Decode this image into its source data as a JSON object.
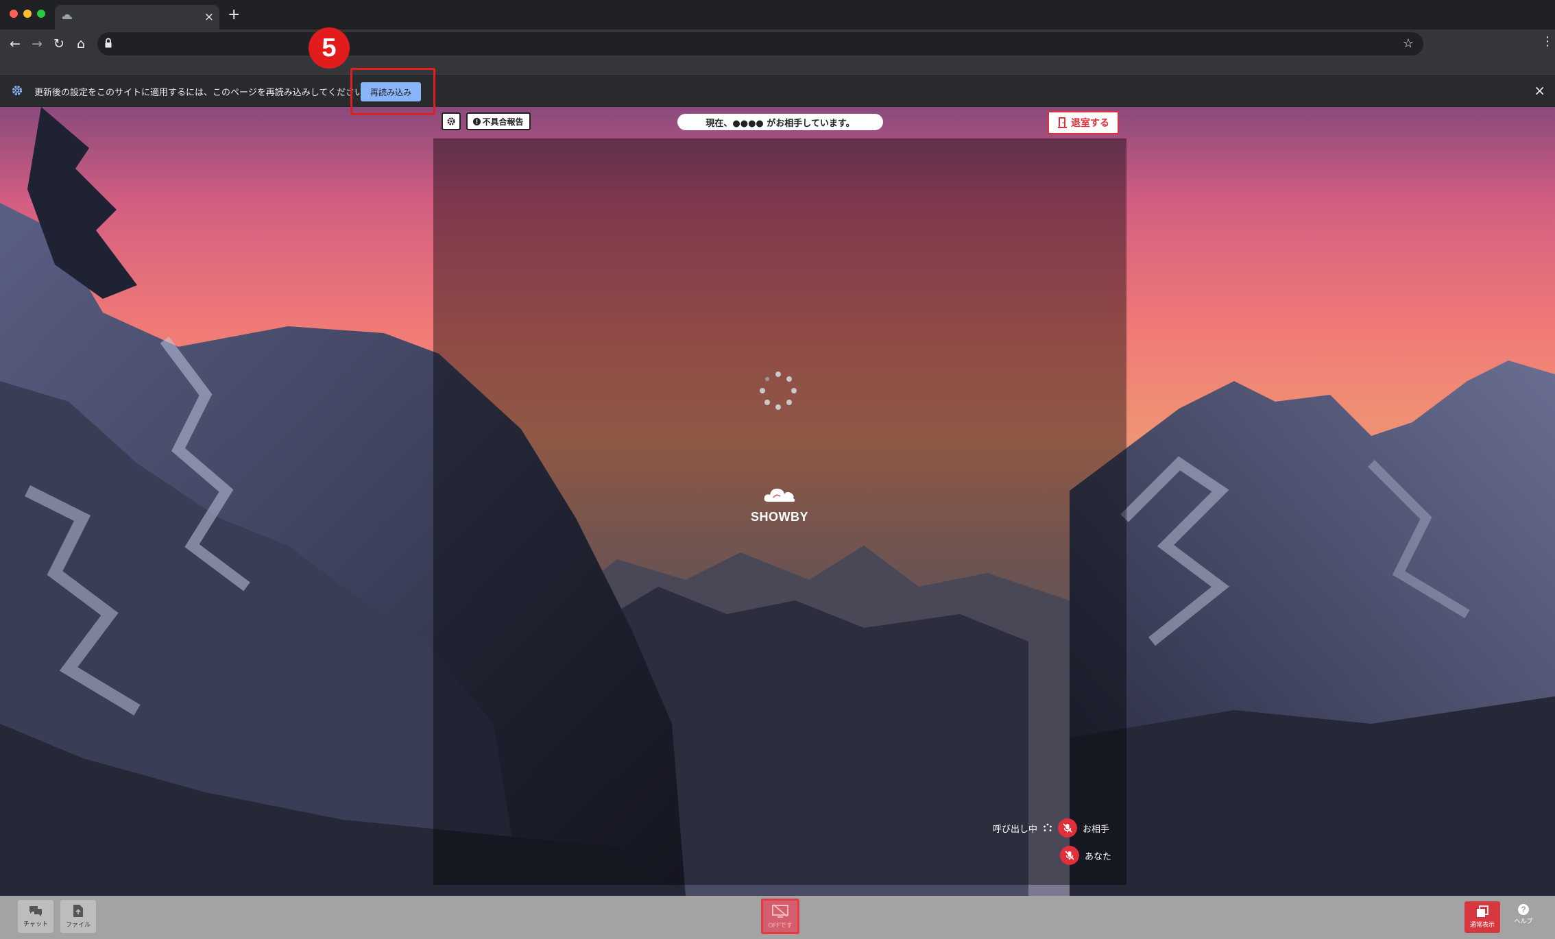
{
  "browser": {
    "tab": {
      "title": "",
      "close_glyph": "×"
    },
    "new_tab_glyph": "+",
    "nav": {
      "back_glyph": "←",
      "forward_glyph": "→",
      "reload_glyph": "↻",
      "home_glyph": "⌂",
      "star_glyph": "☆",
      "menu_glyph": "⋮"
    },
    "address": ""
  },
  "infobar": {
    "message": "更新後の設定をこのサイトに適用するには、このページを再読み込みしてください",
    "reload_button": "再読み込み",
    "close_glyph": "×"
  },
  "annotation": {
    "step_number": "5",
    "color": "#e11f1f"
  },
  "room": {
    "report_button": "不具合報告",
    "status": "現在、●●●● がお相手しています。",
    "leave_button": "退室する",
    "logo_text": "SHOWBY",
    "calling_status": "呼び出し中",
    "partner_label": "お相手",
    "you_label": "あなた"
  },
  "bottom_bar": {
    "chat_label": "チャット",
    "file_label": "ファイル",
    "camera_label": "OFFです",
    "normal_view_label": "通常表示",
    "help_label": "ヘルプ",
    "help_glyph": "?"
  },
  "colors": {
    "accent_red": "#e0303a",
    "infobar_button": "#8ab4f8",
    "chrome_dark": "#202124",
    "bottom_bar": "#a3a3a3"
  }
}
